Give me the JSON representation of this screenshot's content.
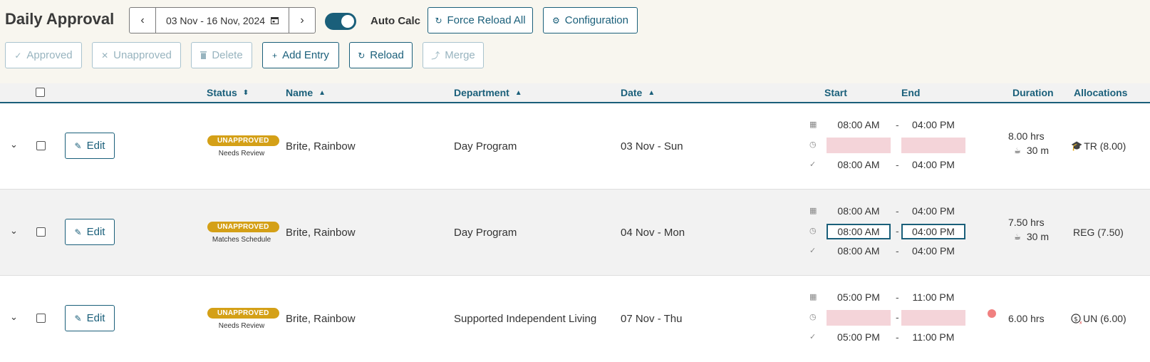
{
  "header": {
    "title": "Daily Approval",
    "date_range": "03 Nov - 16 Nov, 2024",
    "prev_glyph": "‹",
    "next_glyph": "›",
    "auto_calc_label": "Auto Calc",
    "auto_calc_on": true,
    "force_reload_label": "Force Reload All",
    "configuration_label": "Configuration"
  },
  "toolbar": {
    "approved_label": "Approved",
    "unapproved_label": "Unapproved",
    "delete_label": "Delete",
    "add_entry_label": "Add Entry",
    "reload_label": "Reload",
    "merge_label": "Merge"
  },
  "columns": {
    "status": "Status",
    "name": "Name",
    "department": "Department",
    "date": "Date",
    "start": "Start",
    "end": "End",
    "duration": "Duration",
    "allocations": "Allocations"
  },
  "rows": [
    {
      "edit_label": "Edit",
      "status_badge": "UNAPPROVED",
      "status_note": "Needs Review",
      "name": "Brite, Rainbow",
      "department": "Day Program",
      "date": "03 Nov - Sun",
      "scheduled_start": "08:00 AM",
      "scheduled_end": "04:00 PM",
      "clocked_start": "",
      "clocked_end": "",
      "approved_start": "08:00 AM",
      "approved_end": "04:00 PM",
      "duration": "8.00 hrs",
      "break": "30 m",
      "allocation": "TR (8.00)",
      "allocation_icon": "graduation-cap-icon"
    },
    {
      "edit_label": "Edit",
      "status_badge": "UNAPPROVED",
      "status_note": "Matches Schedule",
      "name": "Brite, Rainbow",
      "department": "Day Program",
      "date": "04 Nov - Mon",
      "scheduled_start": "08:00 AM",
      "scheduled_end": "04:00 PM",
      "clocked_start": "08:00 AM",
      "clocked_end": "04:00 PM",
      "approved_start": "08:00 AM",
      "approved_end": "04:00 PM",
      "duration": "7.50 hrs",
      "break": "30 m",
      "allocation": "REG (7.50)"
    },
    {
      "edit_label": "Edit",
      "status_badge": "UNAPPROVED",
      "status_note": "Needs Review",
      "name": "Brite, Rainbow",
      "department": "Supported Independent Living",
      "date": "07 Nov - Thu",
      "scheduled_start": "05:00 PM",
      "scheduled_end": "11:00 PM",
      "clocked_start": "",
      "clocked_end": "",
      "approved_start": "05:00 PM",
      "approved_end": "11:00 PM",
      "duration": "6.00 hrs",
      "allocation": "UN (6.00)",
      "allocation_icon": "unpaid-dollar-icon"
    }
  ],
  "colors": {
    "accent": "#1a5f7a",
    "badge": "#d4a017",
    "missing_time": "#f4d4d9",
    "alert_dot": "#f08080"
  }
}
